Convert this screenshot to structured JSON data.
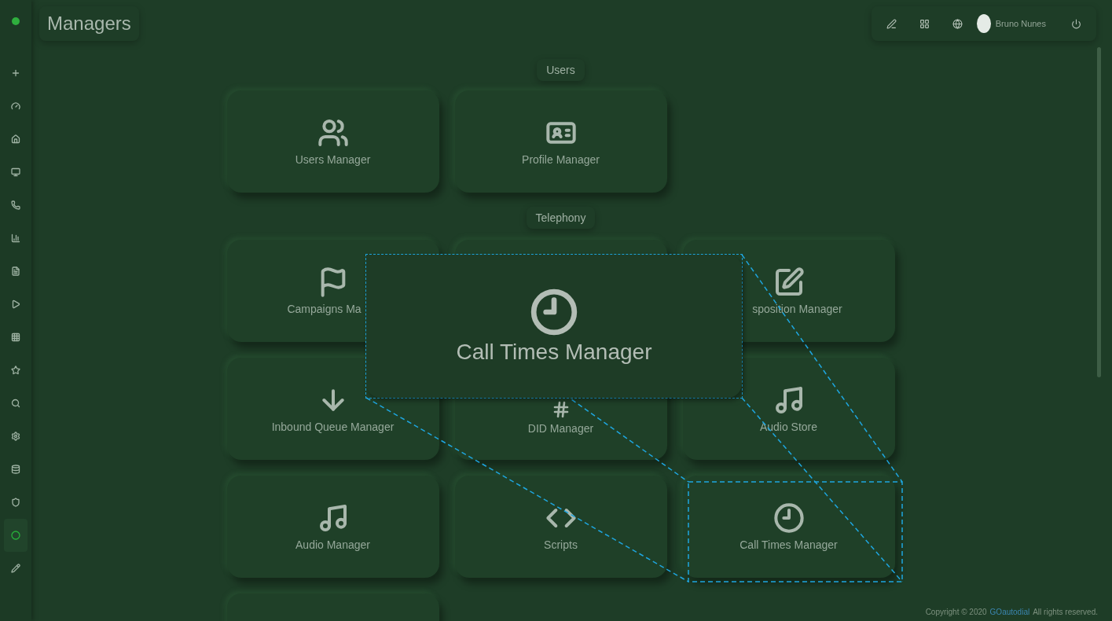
{
  "header": {
    "title": "Managers",
    "user_name": "Bruno Nunes"
  },
  "sidebar": {
    "items": [
      {
        "selected": false
      },
      {
        "selected": false
      },
      {
        "selected": false
      },
      {
        "selected": false
      },
      {
        "selected": false
      },
      {
        "selected": false
      },
      {
        "selected": false
      },
      {
        "selected": false
      },
      {
        "selected": false
      },
      {
        "selected": false
      },
      {
        "selected": false
      },
      {
        "selected": false
      },
      {
        "selected": false
      },
      {
        "selected": false
      },
      {
        "selected": true
      },
      {
        "selected": false
      }
    ]
  },
  "sections": [
    {
      "title": "Users",
      "cards": [
        {
          "kind": "manager",
          "label": "Users Manager"
        },
        {
          "kind": "manager",
          "label": "Profile Manager"
        }
      ]
    },
    {
      "title": "Telephony",
      "cards": [
        {
          "kind": "clipped",
          "label": "Campaigns Ma"
        },
        {
          "kind": "covered"
        },
        {
          "kind": "trimmed",
          "label": "sposition Manager"
        },
        {
          "kind": "manager",
          "label": "Inbound Queue Manager"
        },
        {
          "kind": "lowered",
          "label": "DID Manager"
        },
        {
          "kind": "manager",
          "label": "Audio Store"
        },
        {
          "kind": "manager",
          "label": "Audio Manager"
        },
        {
          "kind": "manager",
          "label": "Scripts"
        },
        {
          "kind": "manager",
          "label": "Call Times Manager"
        },
        {
          "kind": "partial"
        }
      ]
    }
  ],
  "callout": {
    "label": "Call Times Manager"
  },
  "footer": {
    "copyright": "Copyright © 2020",
    "link": "GOautodial",
    "rights": "All rights reserved."
  }
}
